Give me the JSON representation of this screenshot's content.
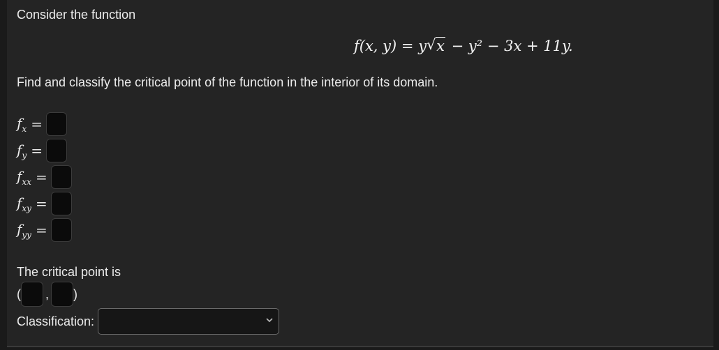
{
  "intro_text": "Consider the function",
  "formula": {
    "lhs": "f(x, y)",
    "eq": "=",
    "y_coef": "y",
    "radicand": "x",
    "rest": " − y² − 3x + 11y."
  },
  "instruction_text": "Find and classify the critical point of the function in the interior of its domain.",
  "derivatives": [
    {
      "base": "f",
      "sub": "x",
      "eq": "="
    },
    {
      "base": "f",
      "sub": "y",
      "eq": "="
    },
    {
      "base": "f",
      "sub": "xx",
      "eq": "="
    },
    {
      "base": "f",
      "sub": "xy",
      "eq": "="
    },
    {
      "base": "f",
      "sub": "yy",
      "eq": "="
    }
  ],
  "critical_point": {
    "label": "The critical point is",
    "open": "(",
    "sep": ",",
    "close": ")"
  },
  "classification": {
    "label": "Classification:",
    "selected": "",
    "icon": "chevron-down-icon"
  },
  "colors": {
    "background": "#242424",
    "input_fill": "#0b0b0b",
    "text": "#ececec"
  }
}
